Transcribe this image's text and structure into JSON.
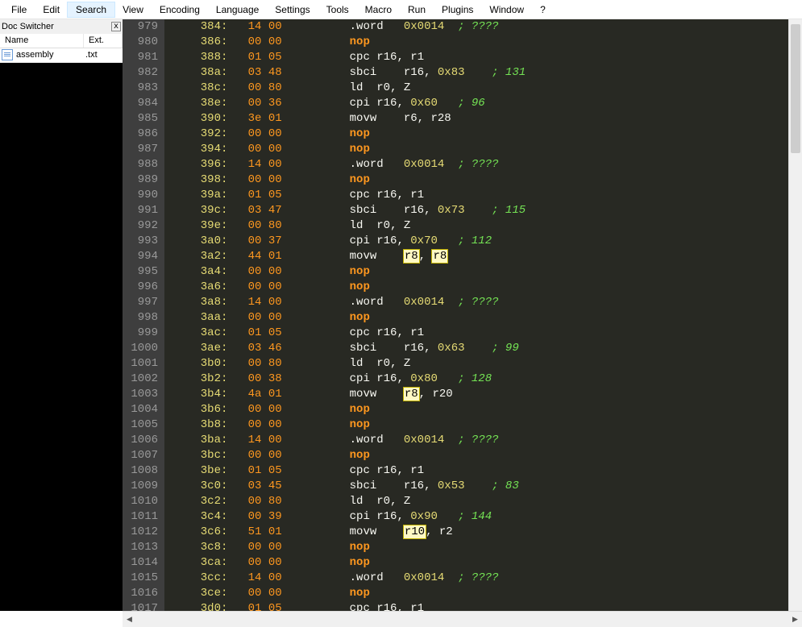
{
  "menubar": [
    "File",
    "Edit",
    "Search",
    "View",
    "Encoding",
    "Language",
    "Settings",
    "Tools",
    "Macro",
    "Run",
    "Plugins",
    "Window",
    "?"
  ],
  "menubar_active": "Search",
  "doc_switcher": {
    "title": "Doc Switcher",
    "cols": {
      "name": "Name",
      "ext": "Ext."
    },
    "files": [
      {
        "name": "assembly",
        "ext": ".txt"
      }
    ]
  },
  "lines": [
    {
      "n": 979,
      "addr": "384",
      "b": "14 00",
      "tokens": [
        {
          "t": "mnem",
          "s": ".word"
        },
        {
          "t": "sp",
          "s": "   "
        },
        {
          "t": "num",
          "s": "0x0014"
        },
        {
          "t": "sp",
          "s": "  "
        },
        {
          "t": "comm",
          "s": "; ????"
        }
      ]
    },
    {
      "n": 980,
      "addr": "386",
      "b": "00 00",
      "tokens": [
        {
          "t": "nop",
          "s": "nop"
        }
      ]
    },
    {
      "n": 981,
      "addr": "388",
      "b": "01 05",
      "tokens": [
        {
          "t": "mnem",
          "s": "cpc r16"
        },
        {
          "t": "punc",
          "s": ", "
        },
        {
          "t": "mnem",
          "s": "r1"
        }
      ]
    },
    {
      "n": 982,
      "addr": "38a",
      "b": "03 48",
      "tokens": [
        {
          "t": "mnem",
          "s": "sbci"
        },
        {
          "t": "sp",
          "s": "    "
        },
        {
          "t": "mnem",
          "s": "r16"
        },
        {
          "t": "punc",
          "s": ", "
        },
        {
          "t": "num",
          "s": "0x83"
        },
        {
          "t": "sp",
          "s": "    "
        },
        {
          "t": "comm",
          "s": "; 131"
        }
      ]
    },
    {
      "n": 983,
      "addr": "38c",
      "b": "00 80",
      "tokens": [
        {
          "t": "mnem",
          "s": "ld  r0"
        },
        {
          "t": "punc",
          "s": ", "
        },
        {
          "t": "mnem",
          "s": "Z"
        }
      ]
    },
    {
      "n": 984,
      "addr": "38e",
      "b": "00 36",
      "tokens": [
        {
          "t": "mnem",
          "s": "cpi r16"
        },
        {
          "t": "punc",
          "s": ", "
        },
        {
          "t": "num",
          "s": "0x60"
        },
        {
          "t": "sp",
          "s": "   "
        },
        {
          "t": "comm",
          "s": "; 96"
        }
      ]
    },
    {
      "n": 985,
      "addr": "390",
      "b": "3e 01",
      "tokens": [
        {
          "t": "mnem",
          "s": "movw"
        },
        {
          "t": "sp",
          "s": "    "
        },
        {
          "t": "mnem",
          "s": "r6"
        },
        {
          "t": "punc",
          "s": ", "
        },
        {
          "t": "mnem",
          "s": "r28"
        }
      ]
    },
    {
      "n": 986,
      "addr": "392",
      "b": "00 00",
      "tokens": [
        {
          "t": "nop",
          "s": "nop"
        }
      ]
    },
    {
      "n": 987,
      "addr": "394",
      "b": "00 00",
      "tokens": [
        {
          "t": "nop",
          "s": "nop"
        }
      ]
    },
    {
      "n": 988,
      "addr": "396",
      "b": "14 00",
      "tokens": [
        {
          "t": "mnem",
          "s": ".word"
        },
        {
          "t": "sp",
          "s": "   "
        },
        {
          "t": "num",
          "s": "0x0014"
        },
        {
          "t": "sp",
          "s": "  "
        },
        {
          "t": "comm",
          "s": "; ????"
        }
      ]
    },
    {
      "n": 989,
      "addr": "398",
      "b": "00 00",
      "tokens": [
        {
          "t": "nop",
          "s": "nop"
        }
      ]
    },
    {
      "n": 990,
      "addr": "39a",
      "b": "01 05",
      "tokens": [
        {
          "t": "mnem",
          "s": "cpc r16"
        },
        {
          "t": "punc",
          "s": ", "
        },
        {
          "t": "mnem",
          "s": "r1"
        }
      ]
    },
    {
      "n": 991,
      "addr": "39c",
      "b": "03 47",
      "tokens": [
        {
          "t": "mnem",
          "s": "sbci"
        },
        {
          "t": "sp",
          "s": "    "
        },
        {
          "t": "mnem",
          "s": "r16"
        },
        {
          "t": "punc",
          "s": ", "
        },
        {
          "t": "num",
          "s": "0x73"
        },
        {
          "t": "sp",
          "s": "    "
        },
        {
          "t": "comm",
          "s": "; 115"
        }
      ]
    },
    {
      "n": 992,
      "addr": "39e",
      "b": "00 80",
      "tokens": [
        {
          "t": "mnem",
          "s": "ld  r0"
        },
        {
          "t": "punc",
          "s": ", "
        },
        {
          "t": "mnem",
          "s": "Z"
        }
      ]
    },
    {
      "n": 993,
      "addr": "3a0",
      "b": "00 37",
      "tokens": [
        {
          "t": "mnem",
          "s": "cpi r16"
        },
        {
          "t": "punc",
          "s": ", "
        },
        {
          "t": "num",
          "s": "0x70"
        },
        {
          "t": "sp",
          "s": "   "
        },
        {
          "t": "comm",
          "s": "; 112"
        }
      ]
    },
    {
      "n": 994,
      "addr": "3a2",
      "b": "44 01",
      "tokens": [
        {
          "t": "mnem",
          "s": "movw"
        },
        {
          "t": "sp",
          "s": "    "
        },
        {
          "t": "hl",
          "s": "r8"
        },
        {
          "t": "punc",
          "s": ", "
        },
        {
          "t": "hl",
          "s": "r8"
        }
      ]
    },
    {
      "n": 995,
      "addr": "3a4",
      "b": "00 00",
      "tokens": [
        {
          "t": "nop",
          "s": "nop"
        }
      ]
    },
    {
      "n": 996,
      "addr": "3a6",
      "b": "00 00",
      "tokens": [
        {
          "t": "nop",
          "s": "nop"
        }
      ]
    },
    {
      "n": 997,
      "addr": "3a8",
      "b": "14 00",
      "tokens": [
        {
          "t": "mnem",
          "s": ".word"
        },
        {
          "t": "sp",
          "s": "   "
        },
        {
          "t": "num",
          "s": "0x0014"
        },
        {
          "t": "sp",
          "s": "  "
        },
        {
          "t": "comm",
          "s": "; ????"
        }
      ]
    },
    {
      "n": 998,
      "addr": "3aa",
      "b": "00 00",
      "tokens": [
        {
          "t": "nop",
          "s": "nop"
        }
      ]
    },
    {
      "n": 999,
      "addr": "3ac",
      "b": "01 05",
      "tokens": [
        {
          "t": "mnem",
          "s": "cpc r16"
        },
        {
          "t": "punc",
          "s": ", "
        },
        {
          "t": "mnem",
          "s": "r1"
        }
      ]
    },
    {
      "n": 1000,
      "addr": "3ae",
      "b": "03 46",
      "tokens": [
        {
          "t": "mnem",
          "s": "sbci"
        },
        {
          "t": "sp",
          "s": "    "
        },
        {
          "t": "mnem",
          "s": "r16"
        },
        {
          "t": "punc",
          "s": ", "
        },
        {
          "t": "num",
          "s": "0x63"
        },
        {
          "t": "sp",
          "s": "    "
        },
        {
          "t": "comm",
          "s": "; 99"
        }
      ]
    },
    {
      "n": 1001,
      "addr": "3b0",
      "b": "00 80",
      "tokens": [
        {
          "t": "mnem",
          "s": "ld  r0"
        },
        {
          "t": "punc",
          "s": ", "
        },
        {
          "t": "mnem",
          "s": "Z"
        }
      ]
    },
    {
      "n": 1002,
      "addr": "3b2",
      "b": "00 38",
      "tokens": [
        {
          "t": "mnem",
          "s": "cpi r16"
        },
        {
          "t": "punc",
          "s": ", "
        },
        {
          "t": "num",
          "s": "0x80"
        },
        {
          "t": "sp",
          "s": "   "
        },
        {
          "t": "comm",
          "s": "; 128"
        }
      ]
    },
    {
      "n": 1003,
      "addr": "3b4",
      "b": "4a 01",
      "tokens": [
        {
          "t": "mnem",
          "s": "movw"
        },
        {
          "t": "sp",
          "s": "    "
        },
        {
          "t": "hl",
          "s": "r8"
        },
        {
          "t": "punc",
          "s": ", "
        },
        {
          "t": "mnem",
          "s": "r20"
        }
      ]
    },
    {
      "n": 1004,
      "addr": "3b6",
      "b": "00 00",
      "tokens": [
        {
          "t": "nop",
          "s": "nop"
        }
      ]
    },
    {
      "n": 1005,
      "addr": "3b8",
      "b": "00 00",
      "tokens": [
        {
          "t": "nop",
          "s": "nop"
        }
      ]
    },
    {
      "n": 1006,
      "addr": "3ba",
      "b": "14 00",
      "tokens": [
        {
          "t": "mnem",
          "s": ".word"
        },
        {
          "t": "sp",
          "s": "   "
        },
        {
          "t": "num",
          "s": "0x0014"
        },
        {
          "t": "sp",
          "s": "  "
        },
        {
          "t": "comm",
          "s": "; ????"
        }
      ]
    },
    {
      "n": 1007,
      "addr": "3bc",
      "b": "00 00",
      "tokens": [
        {
          "t": "nop",
          "s": "nop"
        }
      ]
    },
    {
      "n": 1008,
      "addr": "3be",
      "b": "01 05",
      "tokens": [
        {
          "t": "mnem",
          "s": "cpc r16"
        },
        {
          "t": "punc",
          "s": ", "
        },
        {
          "t": "mnem",
          "s": "r1"
        }
      ]
    },
    {
      "n": 1009,
      "addr": "3c0",
      "b": "03 45",
      "tokens": [
        {
          "t": "mnem",
          "s": "sbci"
        },
        {
          "t": "sp",
          "s": "    "
        },
        {
          "t": "mnem",
          "s": "r16"
        },
        {
          "t": "punc",
          "s": ", "
        },
        {
          "t": "num",
          "s": "0x53"
        },
        {
          "t": "sp",
          "s": "    "
        },
        {
          "t": "comm",
          "s": "; 83"
        }
      ]
    },
    {
      "n": 1010,
      "addr": "3c2",
      "b": "00 80",
      "tokens": [
        {
          "t": "mnem",
          "s": "ld  r0"
        },
        {
          "t": "punc",
          "s": ", "
        },
        {
          "t": "mnem",
          "s": "Z"
        }
      ]
    },
    {
      "n": 1011,
      "addr": "3c4",
      "b": "00 39",
      "tokens": [
        {
          "t": "mnem",
          "s": "cpi r16"
        },
        {
          "t": "punc",
          "s": ", "
        },
        {
          "t": "num",
          "s": "0x90"
        },
        {
          "t": "sp",
          "s": "   "
        },
        {
          "t": "comm",
          "s": "; 144"
        }
      ]
    },
    {
      "n": 1012,
      "addr": "3c6",
      "b": "51 01",
      "tokens": [
        {
          "t": "mnem",
          "s": "movw"
        },
        {
          "t": "sp",
          "s": "    "
        },
        {
          "t": "hl",
          "s": "r10"
        },
        {
          "t": "punc",
          "s": ", "
        },
        {
          "t": "mnem",
          "s": "r2"
        }
      ]
    },
    {
      "n": 1013,
      "addr": "3c8",
      "b": "00 00",
      "tokens": [
        {
          "t": "nop",
          "s": "nop"
        }
      ]
    },
    {
      "n": 1014,
      "addr": "3ca",
      "b": "00 00",
      "tokens": [
        {
          "t": "nop",
          "s": "nop"
        }
      ]
    },
    {
      "n": 1015,
      "addr": "3cc",
      "b": "14 00",
      "tokens": [
        {
          "t": "mnem",
          "s": ".word"
        },
        {
          "t": "sp",
          "s": "   "
        },
        {
          "t": "num",
          "s": "0x0014"
        },
        {
          "t": "sp",
          "s": "  "
        },
        {
          "t": "comm",
          "s": "; ????"
        }
      ]
    },
    {
      "n": 1016,
      "addr": "3ce",
      "b": "00 00",
      "tokens": [
        {
          "t": "nop",
          "s": "nop"
        }
      ]
    },
    {
      "n": 1017,
      "addr": "3d0",
      "b": "01 05",
      "tokens": [
        {
          "t": "mnem",
          "s": "cpc r16"
        },
        {
          "t": "punc",
          "s": ", "
        },
        {
          "t": "mnem",
          "s": "r1"
        }
      ]
    }
  ]
}
